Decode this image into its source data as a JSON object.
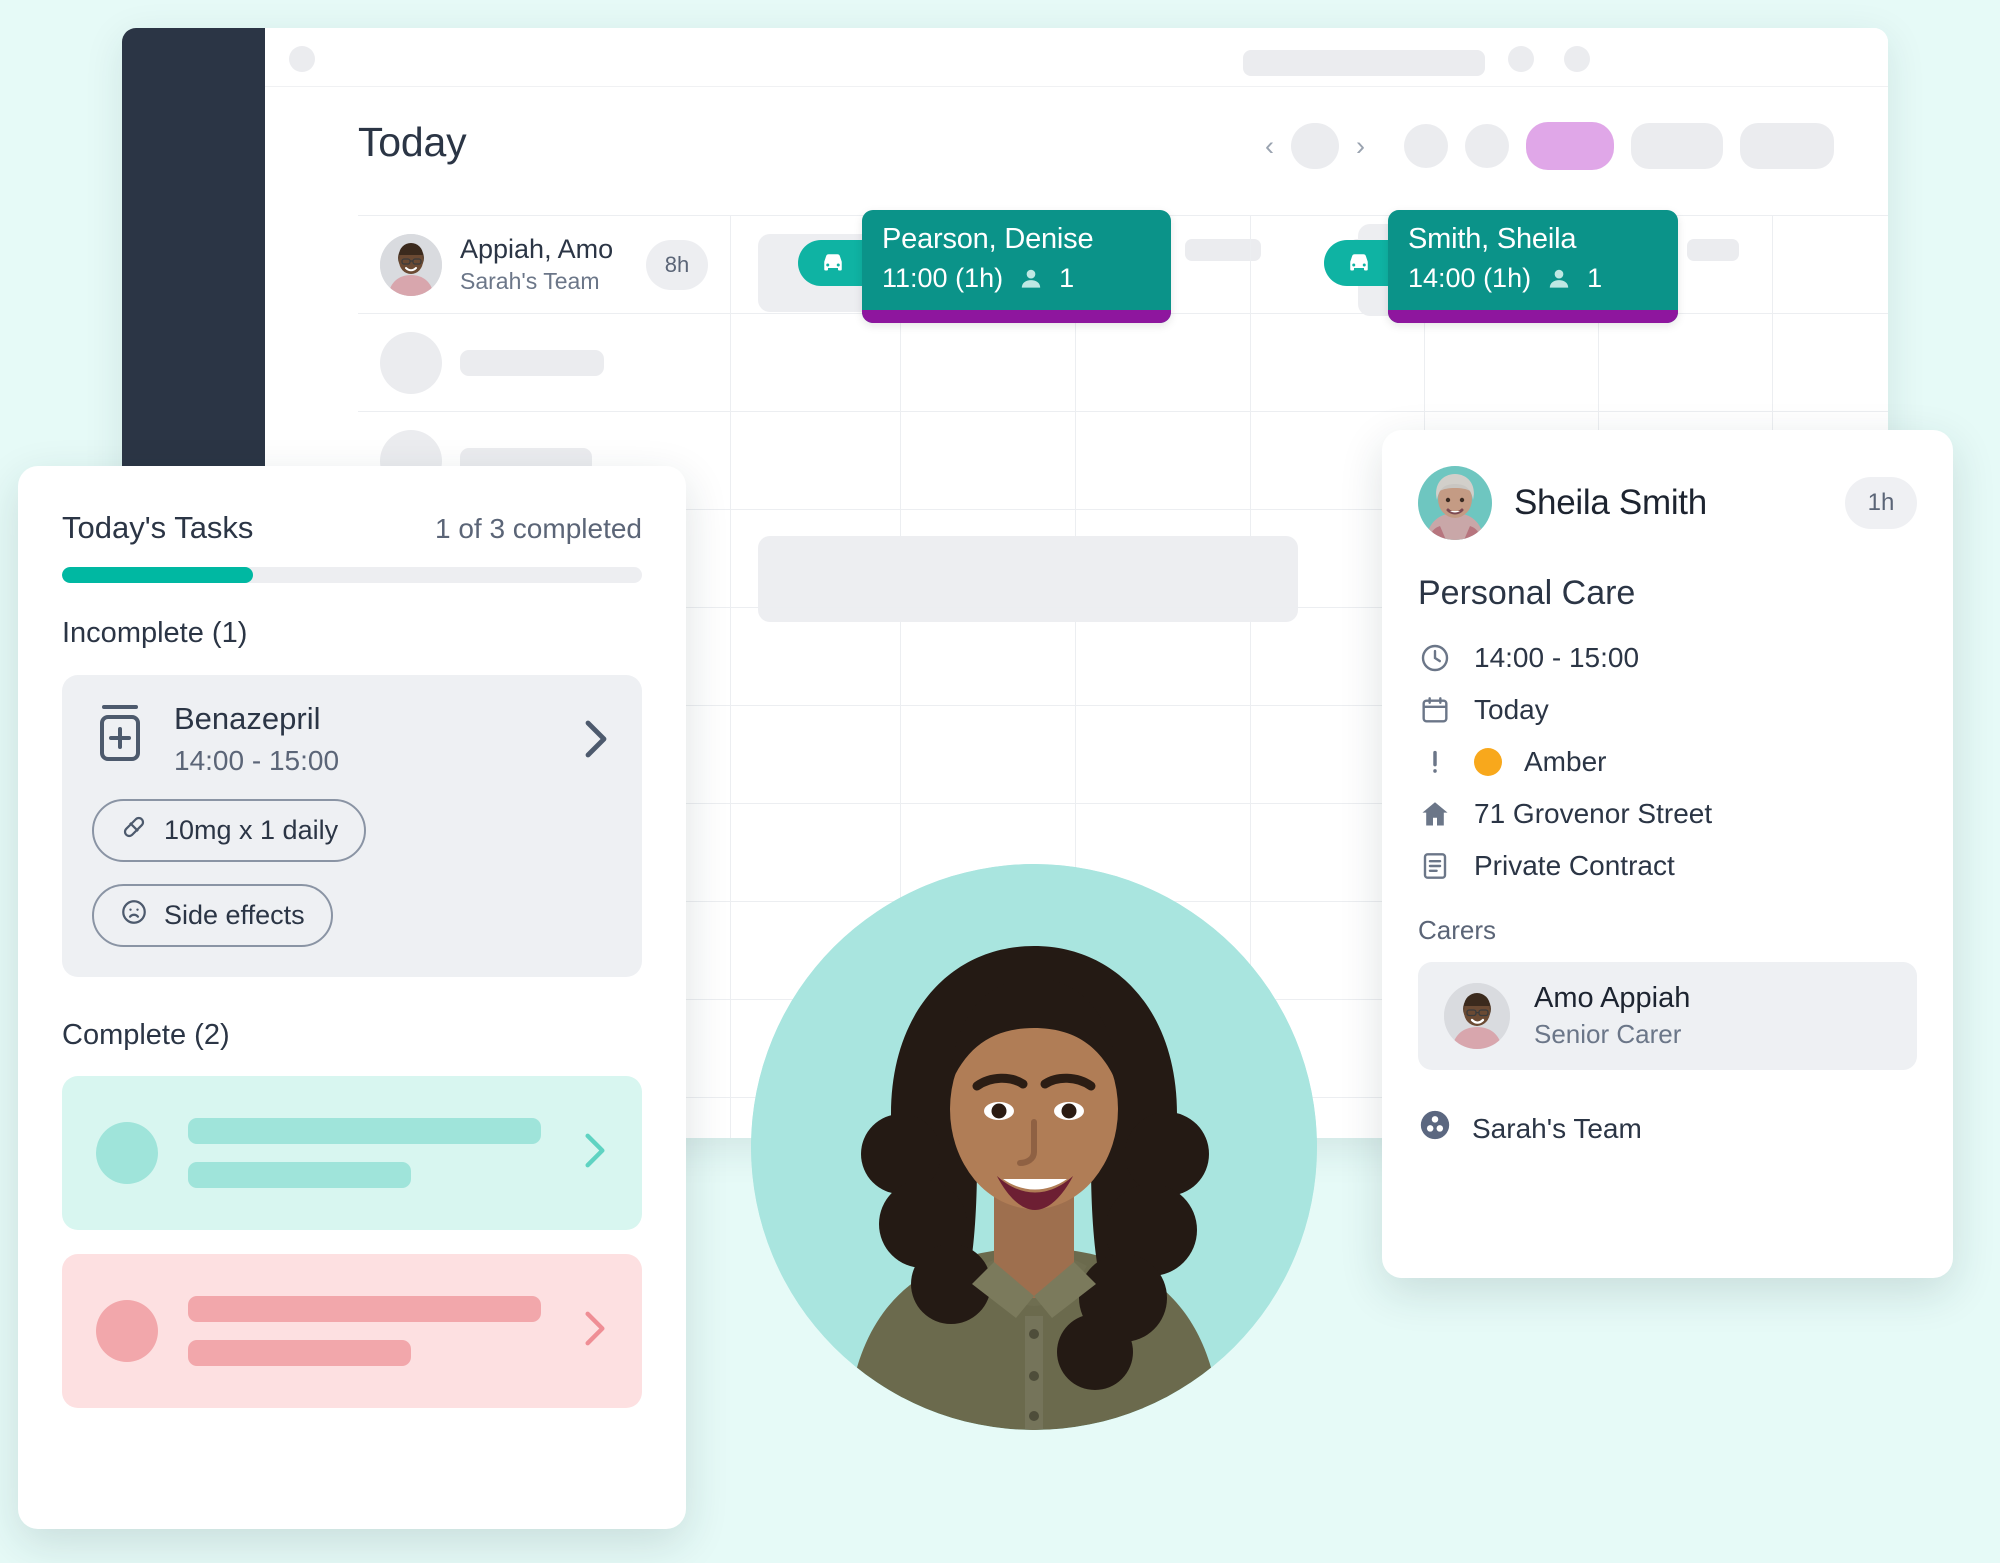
{
  "app": {
    "page_title": "Today"
  },
  "calendar": {
    "rows": [
      {
        "carer_name": "Appiah, Amo",
        "team": "Sarah's Team",
        "hours": "8h",
        "appointments": [
          {
            "client": "Pearson, Denise",
            "time": "11:00 (1h)",
            "people": "1",
            "travel_icon": "car-icon"
          },
          {
            "client": "Smith, Sheila",
            "time": "14:00 (1h)",
            "people": "1",
            "travel_icon": "car-icon"
          }
        ]
      }
    ],
    "nav": {
      "prev_icon": "chevron-left-icon",
      "next_icon": "chevron-right-icon"
    }
  },
  "tasks": {
    "title": "Today's Tasks",
    "completed_label": "1 of 3 completed",
    "progress_percent": 33,
    "incomplete_label": "Incomplete (1)",
    "complete_label": "Complete (2)",
    "incomplete_items": [
      {
        "icon": "medication-bottle-icon",
        "name": "Benazepril",
        "time": "14:00 - 15:00",
        "chips": [
          {
            "icon": "pill-icon",
            "label": "10mg x 1 daily"
          },
          {
            "icon": "sad-face-icon",
            "label": "Side effects"
          }
        ],
        "chevron": "chevron-right-icon"
      }
    ],
    "complete_items": [
      {
        "accent": "#00b8a2",
        "bg": "#d8f6f0",
        "fill": "#9fe4da",
        "chevron": "chevron-right-icon"
      },
      {
        "accent": "#f09097",
        "bg": "#fde0e1",
        "fill": "#f2a7ab",
        "chevron": "chevron-right-icon"
      }
    ]
  },
  "detail": {
    "client_name": "Sheila Smith",
    "duration": "1h",
    "service": "Personal Care",
    "rows": [
      {
        "icon": "clock-icon",
        "value": "14:00 - 15:00"
      },
      {
        "icon": "calendar-icon",
        "value": "Today"
      },
      {
        "icon": "alert-icon",
        "value": "Amber",
        "dot_color": "#f8a81c"
      },
      {
        "icon": "home-icon",
        "value": "71 Grovenor Street"
      },
      {
        "icon": "document-icon",
        "value": "Private Contract"
      }
    ],
    "carers_label": "Carers",
    "carers": [
      {
        "name": "Amo Appiah",
        "role": "Senior Carer"
      }
    ],
    "team_icon": "team-icon",
    "team_label": "Sarah's Team"
  },
  "colors": {
    "background": "#e6faf7",
    "sidebar": "#2b3545",
    "appointment": "#0b9389",
    "appointment_underline": "#8e169e",
    "travel_pill": "#0fb3a3",
    "progress": "#00b8a2",
    "accent_purple": "#e0a7e8",
    "amber": "#f8a81c",
    "photo_backdrop": "#a9e5df"
  }
}
